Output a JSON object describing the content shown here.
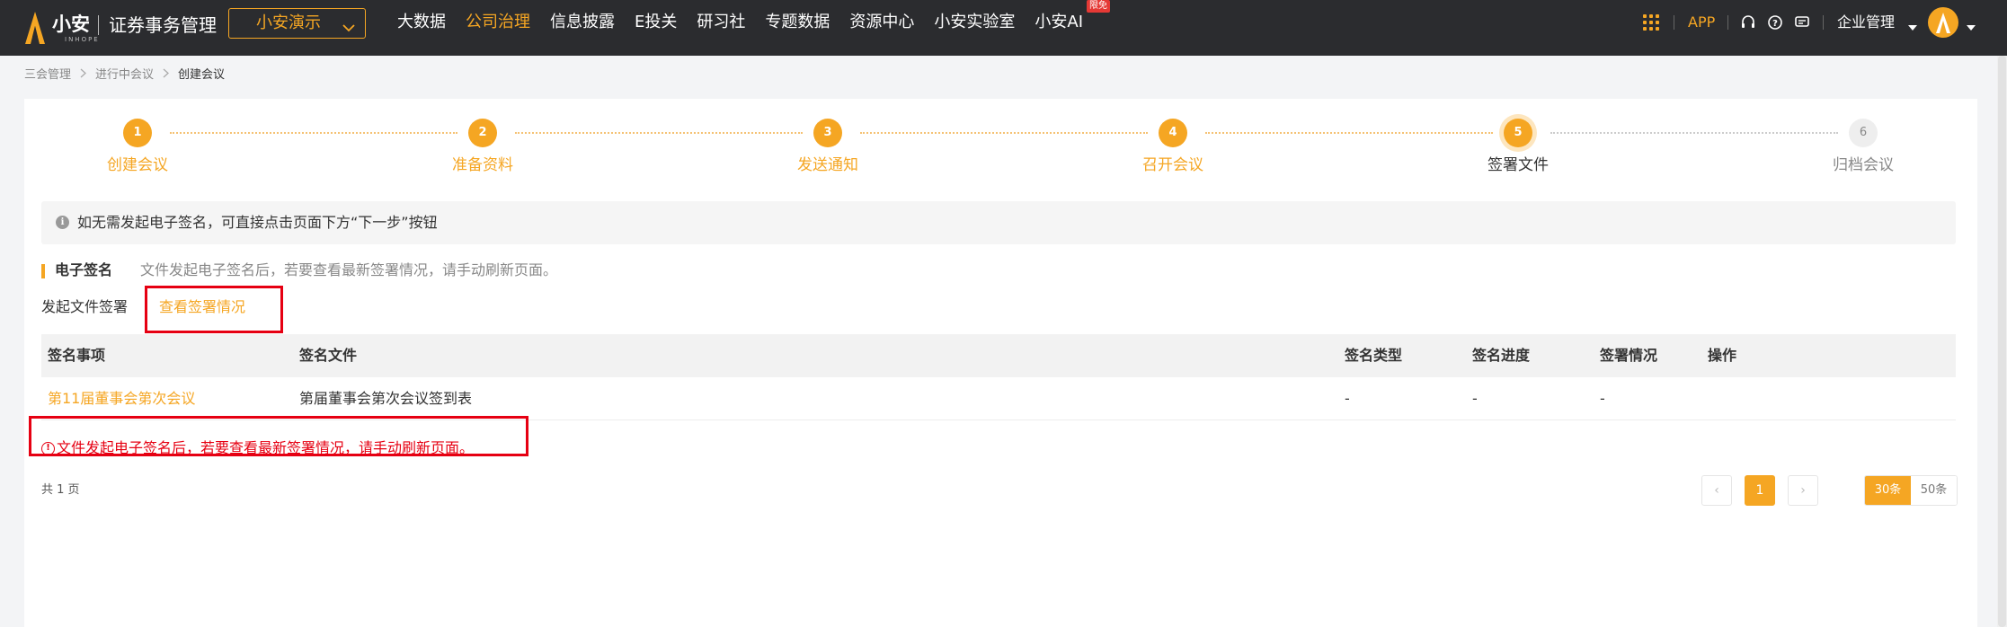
{
  "colors": {
    "accent": "#f5a623",
    "topbar": "#2b2c2f",
    "danger": "#e60012"
  },
  "header": {
    "logo_cn": "小安",
    "logo_en": "INHOPE",
    "system_name": "证券事务管理",
    "org_select": "小安演示",
    "nav": [
      {
        "label": "大数据",
        "active": false
      },
      {
        "label": "公司治理",
        "active": true
      },
      {
        "label": "信息披露",
        "active": false
      },
      {
        "label": "E投关",
        "active": false
      },
      {
        "label": "研习社",
        "active": false
      },
      {
        "label": "专题数据",
        "active": false
      },
      {
        "label": "资源中心",
        "active": false
      },
      {
        "label": "小安实验室",
        "active": false
      },
      {
        "label": "小安AI",
        "active": false,
        "badge": "限免"
      }
    ],
    "app_link": "APP",
    "icons": [
      "apps-grid-icon",
      "headset-icon",
      "help-icon",
      "message-icon"
    ],
    "enterprise_menu": "企业管理"
  },
  "breadcrumb": [
    "三会管理",
    "进行中会议",
    "创建会议"
  ],
  "steps": [
    {
      "num": "1",
      "label": "创建会议",
      "state": "done"
    },
    {
      "num": "2",
      "label": "准备资料",
      "state": "done"
    },
    {
      "num": "3",
      "label": "发送通知",
      "state": "done"
    },
    {
      "num": "4",
      "label": "召开会议",
      "state": "done"
    },
    {
      "num": "5",
      "label": "签署文件",
      "state": "current"
    },
    {
      "num": "6",
      "label": "归档会议",
      "state": "pending"
    }
  ],
  "alert": "如无需发起电子签名，可直接点击页面下方“下一步”按钮",
  "section": {
    "title": "电子签名",
    "desc": "文件发起电子签名后，若要查看最新签署情况，请手动刷新页面。"
  },
  "subtabs": {
    "initiate": "发起文件签署",
    "view": "查看签署情况"
  },
  "table": {
    "headers": [
      "签名事项",
      "签名文件",
      "签名类型",
      "签名进度",
      "签署情况",
      "操作"
    ],
    "rows": [
      [
        "第11届董事会第次会议",
        "第届董事会第次会议签到表",
        "-",
        "-",
        "-",
        ""
      ]
    ]
  },
  "notice": "文件发起电子签名后，若要查看最新签署情况，请手动刷新页面。",
  "pagination": {
    "total_text": "共 1 页",
    "prev": "‹",
    "current_page": "1",
    "next": "›",
    "sizes": [
      {
        "label": "30条",
        "active": true
      },
      {
        "label": "50条",
        "active": false
      }
    ]
  }
}
